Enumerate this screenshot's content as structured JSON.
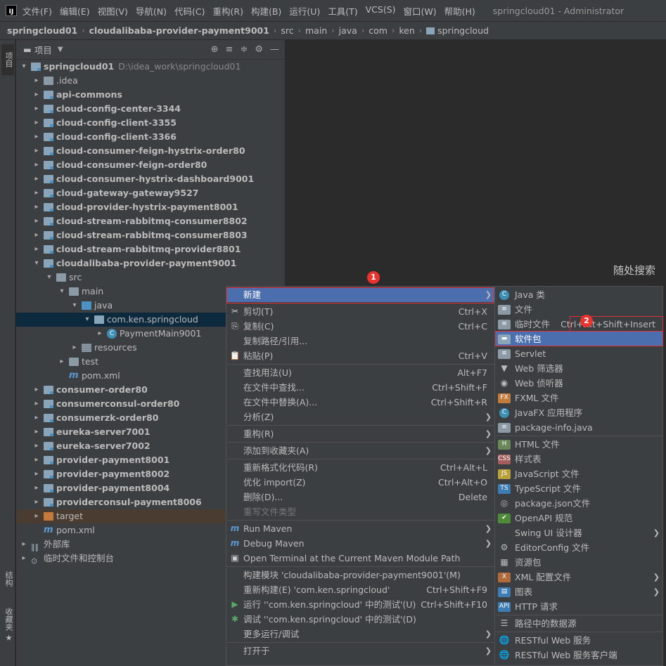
{
  "menubar": {
    "items": [
      "文件(F)",
      "编辑(E)",
      "视图(V)",
      "导航(N)",
      "代码(C)",
      "重构(R)",
      "构建(B)",
      "运行(U)",
      "工具(T)",
      "VCS(S)",
      "窗口(W)",
      "帮助(H)"
    ],
    "title": "springcloud01 - Administrator"
  },
  "breadcrumb": [
    "springcloud01",
    "cloudalibaba-provider-payment9001",
    "src",
    "main",
    "java",
    "com",
    "ken",
    "springcloud"
  ],
  "left_strip": {
    "project": "项目",
    "structure": "结构",
    "favorites": "收藏夹"
  },
  "project_panel": {
    "title": "项目"
  },
  "tree": [
    {
      "label": "springcloud01",
      "path": "D:\\idea_work\\springcloud01",
      "bold": true,
      "indent": 0,
      "arrow": "▾",
      "icon": "fold"
    },
    {
      "label": ".idea",
      "indent": 1,
      "arrow": "▸",
      "icon": "plain"
    },
    {
      "label": "api-commons",
      "bold": true,
      "indent": 1,
      "arrow": "▸",
      "icon": "fold"
    },
    {
      "label": "cloud-config-center-3344",
      "bold": true,
      "indent": 1,
      "arrow": "▸",
      "icon": "fold"
    },
    {
      "label": "cloud-config-client-3355",
      "bold": true,
      "indent": 1,
      "arrow": "▸",
      "icon": "fold"
    },
    {
      "label": "cloud-config-client-3366",
      "bold": true,
      "indent": 1,
      "arrow": "▸",
      "icon": "fold"
    },
    {
      "label": "cloud-consumer-feign-hystrix-order80",
      "bold": true,
      "indent": 1,
      "arrow": "▸",
      "icon": "fold"
    },
    {
      "label": "cloud-consumer-feign-order80",
      "bold": true,
      "indent": 1,
      "arrow": "▸",
      "icon": "fold"
    },
    {
      "label": "cloud-consumer-hystrix-dashboard9001",
      "bold": true,
      "indent": 1,
      "arrow": "▸",
      "icon": "fold"
    },
    {
      "label": "cloud-gateway-gateway9527",
      "bold": true,
      "indent": 1,
      "arrow": "▸",
      "icon": "fold"
    },
    {
      "label": "cloud-provider-hystrix-payment8001",
      "bold": true,
      "indent": 1,
      "arrow": "▸",
      "icon": "fold"
    },
    {
      "label": "cloud-stream-rabbitmq-consumer8802",
      "bold": true,
      "indent": 1,
      "arrow": "▸",
      "icon": "fold"
    },
    {
      "label": "cloud-stream-rabbitmq-consumer8803",
      "bold": true,
      "indent": 1,
      "arrow": "▸",
      "icon": "fold"
    },
    {
      "label": "cloud-stream-rabbitmq-provider8801",
      "bold": true,
      "indent": 1,
      "arrow": "▸",
      "icon": "fold"
    },
    {
      "label": "cloudalibaba-provider-payment9001",
      "bold": true,
      "indent": 1,
      "arrow": "▾",
      "icon": "fold"
    },
    {
      "label": "src",
      "indent": 2,
      "arrow": "▾",
      "icon": "plain"
    },
    {
      "label": "main",
      "indent": 3,
      "arrow": "▾",
      "icon": "plain"
    },
    {
      "label": "java",
      "indent": 4,
      "arrow": "▾",
      "icon": "src"
    },
    {
      "label": "com.ken.springcloud",
      "indent": 5,
      "arrow": "▾",
      "icon": "pkg",
      "selected": true
    },
    {
      "label": "PaymentMain9001",
      "indent": 6,
      "arrow": "▸",
      "icon": "cls"
    },
    {
      "label": "resources",
      "indent": 4,
      "arrow": "▸",
      "icon": "res"
    },
    {
      "label": "test",
      "indent": 3,
      "arrow": "▸",
      "icon": "plain"
    },
    {
      "label": "pom.xml",
      "indent": 3,
      "arrow": "",
      "icon": "mvn"
    },
    {
      "label": "consumer-order80",
      "bold": true,
      "indent": 1,
      "arrow": "▸",
      "icon": "fold"
    },
    {
      "label": "consumerconsul-order80",
      "bold": true,
      "indent": 1,
      "arrow": "▸",
      "icon": "fold"
    },
    {
      "label": "consumerzk-order80",
      "bold": true,
      "indent": 1,
      "arrow": "▸",
      "icon": "fold"
    },
    {
      "label": "eureka-server7001",
      "bold": true,
      "indent": 1,
      "arrow": "▸",
      "icon": "fold"
    },
    {
      "label": "eureka-server7002",
      "bold": true,
      "indent": 1,
      "arrow": "▸",
      "icon": "fold"
    },
    {
      "label": "provider-payment8001",
      "bold": true,
      "indent": 1,
      "arrow": "▸",
      "icon": "fold"
    },
    {
      "label": "provider-payment8002",
      "bold": true,
      "indent": 1,
      "arrow": "▸",
      "icon": "fold"
    },
    {
      "label": "provider-payment8004",
      "bold": true,
      "indent": 1,
      "arrow": "▸",
      "icon": "fold"
    },
    {
      "label": "providerconsul-payment8006",
      "bold": true,
      "indent": 1,
      "arrow": "▸",
      "icon": "fold"
    },
    {
      "label": "target",
      "indent": 1,
      "arrow": "▸",
      "icon": "orange",
      "excluded": true
    },
    {
      "label": "pom.xml",
      "indent": 1,
      "arrow": "",
      "icon": "mvn"
    },
    {
      "label": "外部库",
      "indent": 0,
      "arrow": "▸",
      "icon": "lib"
    },
    {
      "label": "临时文件和控制台",
      "indent": 0,
      "arrow": "▸",
      "icon": "tmp"
    }
  ],
  "editor": {
    "search_hint": "随处搜索"
  },
  "context_menu": [
    {
      "label": "新建",
      "arrow": true,
      "highlight": true
    },
    {
      "sep": true
    },
    {
      "icon": "✂",
      "label": "剪切(T)",
      "shortcut": "Ctrl+X"
    },
    {
      "icon": "⎘",
      "label": "复制(C)",
      "shortcut": "Ctrl+C"
    },
    {
      "label": "复制路径/引用..."
    },
    {
      "icon": "📋",
      "label": "粘贴(P)",
      "shortcut": "Ctrl+V"
    },
    {
      "sep": true
    },
    {
      "label": "查找用法(U)",
      "shortcut": "Alt+F7"
    },
    {
      "label": "在文件中查找...",
      "shortcut": "Ctrl+Shift+F"
    },
    {
      "label": "在文件中替换(A)...",
      "shortcut": "Ctrl+Shift+R"
    },
    {
      "label": "分析(Z)",
      "arrow": true
    },
    {
      "sep": true
    },
    {
      "label": "重构(R)",
      "arrow": true
    },
    {
      "sep": true
    },
    {
      "label": "添加到收藏夹(A)",
      "arrow": true
    },
    {
      "sep": true
    },
    {
      "label": "重新格式化代码(R)",
      "shortcut": "Ctrl+Alt+L"
    },
    {
      "label": "优化 import(Z)",
      "shortcut": "Ctrl+Alt+O"
    },
    {
      "label": "删除(D)...",
      "shortcut": "Delete"
    },
    {
      "label": "重写文件类型",
      "disabled": true
    },
    {
      "sep": true
    },
    {
      "icon": "m",
      "label": "Run Maven",
      "arrow": true
    },
    {
      "icon": "m",
      "label": "Debug Maven",
      "arrow": true
    },
    {
      "icon": "▣",
      "label": "Open Terminal at the Current Maven Module Path"
    },
    {
      "sep": true
    },
    {
      "label": "构建模块 'cloudalibaba-provider-payment9001'(M)"
    },
    {
      "label": "重新构建(E) 'com.ken.springcloud'",
      "shortcut": "Ctrl+Shift+F9"
    },
    {
      "icon": "▶",
      "label": "运行 ''com.ken.springcloud' 中的测试'(U)",
      "shortcut": "Ctrl+Shift+F10"
    },
    {
      "icon": "✱",
      "label": "调试 ''com.ken.springcloud' 中的测试'(D)"
    },
    {
      "label": "更多运行/调试",
      "arrow": true
    },
    {
      "sep": true
    },
    {
      "label": "打开于",
      "arrow": true
    }
  ],
  "submenu": [
    {
      "icon": "C",
      "color": "#3d8fb3",
      "label": "Java 类"
    },
    {
      "icon": "≡",
      "color": "#8c9aa6",
      "label": "文件"
    },
    {
      "icon": "≡",
      "color": "#8c9aa6",
      "label": "临时文件",
      "shortcut": "Ctrl+Alt+Shift+Insert"
    },
    {
      "icon": "▬",
      "color": "#8aa4b9",
      "label": "软件包",
      "highlight": true
    },
    {
      "icon": "≡",
      "color": "#8c9aa6",
      "label": "Servlet"
    },
    {
      "icon": "▼",
      "color": "transparent",
      "label": "Web 筛选器"
    },
    {
      "icon": "◉",
      "color": "transparent",
      "label": "Web 侦听器"
    },
    {
      "icon": "FX",
      "color": "#c27b3c",
      "label": "FXML 文件"
    },
    {
      "icon": "C",
      "color": "#3d8fb3",
      "label": "JavaFX 应用程序"
    },
    {
      "icon": "≡",
      "color": "#8c9aa6",
      "label": "package-info.java"
    },
    {
      "sep": true
    },
    {
      "icon": "H",
      "color": "#6a8759",
      "label": "HTML 文件"
    },
    {
      "icon": "CSS",
      "color": "#a45c5c",
      "label": "样式表"
    },
    {
      "icon": "JS",
      "color": "#b8a13c",
      "label": "JavaScript 文件"
    },
    {
      "icon": "TS",
      "color": "#3d7db3",
      "label": "TypeScript 文件"
    },
    {
      "icon": "◎",
      "color": "transparent",
      "label": "package.json文件"
    },
    {
      "icon": "✔",
      "color": "#4f8a3a",
      "label": "OpenAPI 规范"
    },
    {
      "icon": "",
      "color": "transparent",
      "label": "Swing UI 设计器",
      "arrow": true
    },
    {
      "icon": "⚙",
      "color": "transparent",
      "label": "EditorConfig 文件"
    },
    {
      "icon": "▦",
      "color": "transparent",
      "label": "资源包"
    },
    {
      "icon": "X",
      "color": "#b06a3c",
      "label": "XML 配置文件",
      "arrow": true
    },
    {
      "icon": "▤",
      "color": "#3d7db3",
      "label": "图表",
      "arrow": true
    },
    {
      "icon": "API",
      "color": "#3d7db3",
      "label": "HTTP 请求"
    },
    {
      "sep": true
    },
    {
      "icon": "☰",
      "color": "transparent",
      "label": "路径中的数据源"
    },
    {
      "sep": true
    },
    {
      "icon": "🌐",
      "color": "transparent",
      "label": "RESTful Web 服务"
    },
    {
      "icon": "🌐",
      "color": "transparent",
      "label": "RESTful Web 服务客户端"
    }
  ],
  "annotations": {
    "badge1": "1",
    "badge2": "2"
  }
}
